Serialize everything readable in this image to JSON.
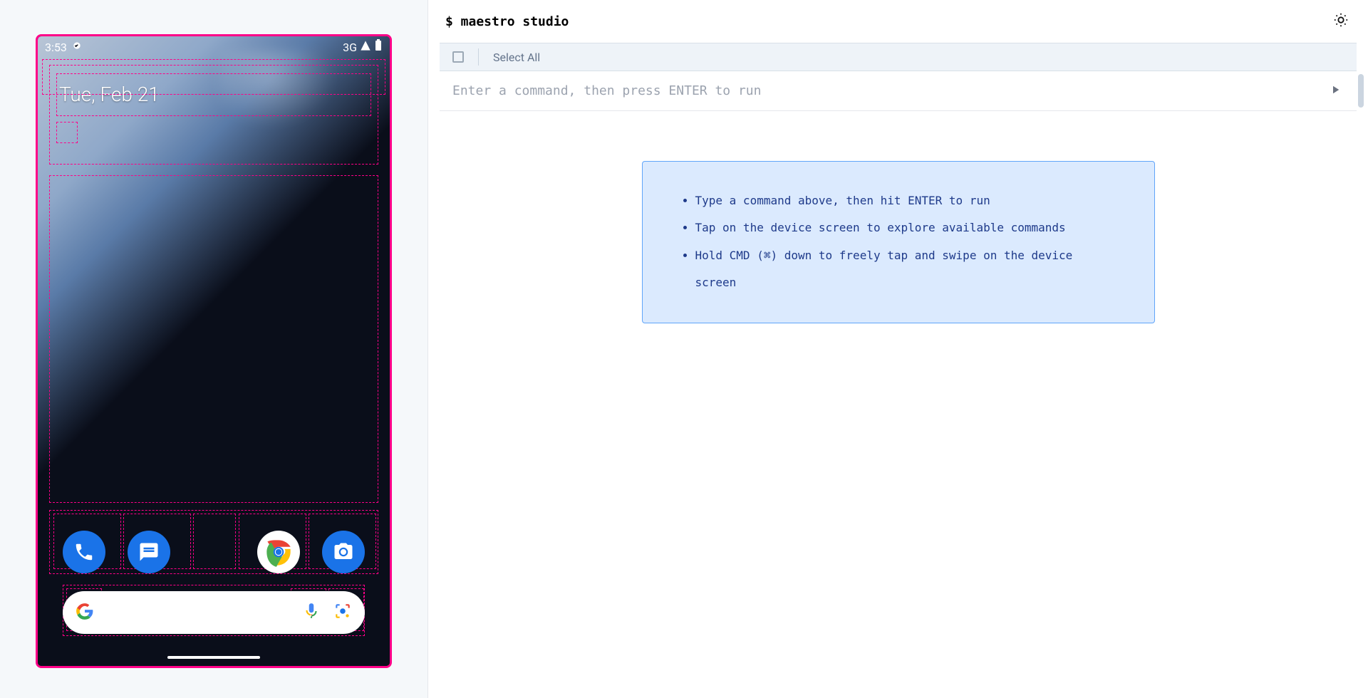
{
  "header": {
    "title": "$ maestro studio"
  },
  "toolbar": {
    "select_all_label": "Select All"
  },
  "command": {
    "placeholder": "Enter a command, then press ENTER to run",
    "value": ""
  },
  "hints": {
    "items": [
      "Type a command above, then hit ENTER to run",
      "Tap on the device screen to explore available commands",
      "Hold CMD (⌘) down to freely tap and swipe on the device screen"
    ]
  },
  "device": {
    "status": {
      "time": "3:53",
      "network": "3G"
    },
    "date_widget": "Tue, Feb 21",
    "dock": [
      {
        "name": "Phone"
      },
      {
        "name": "Messages"
      },
      {
        "name": ""
      },
      {
        "name": "Chrome"
      },
      {
        "name": "Camera"
      }
    ],
    "search": {
      "placeholder": ""
    }
  },
  "colors": {
    "inspector_border": "#ff0088",
    "accent": "#1a73e8",
    "hint_bg": "#dbeafe",
    "hint_border": "#60a5fa"
  }
}
